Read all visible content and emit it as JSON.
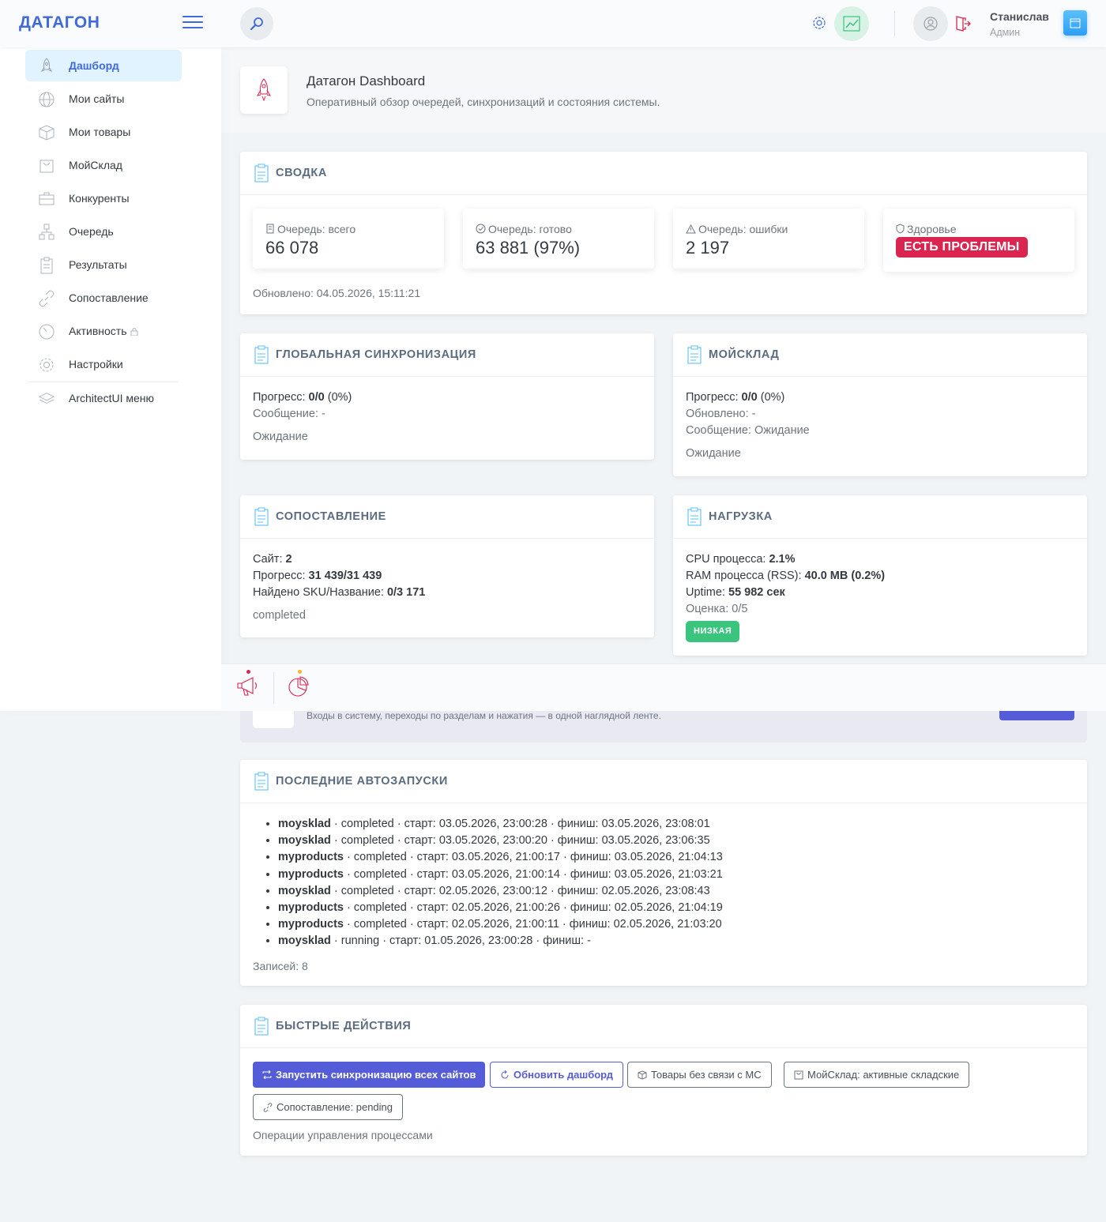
{
  "header": {
    "logo": "ДАТАГОН",
    "user_name": "Станислав",
    "user_role": "Админ"
  },
  "sidebar": {
    "items": [
      {
        "label": "Дашборд",
        "icon": "rocket-icon",
        "active": true
      },
      {
        "label": "Мои сайты",
        "icon": "globe-icon"
      },
      {
        "label": "Мои товары",
        "icon": "box-icon"
      },
      {
        "label": "МойСклад",
        "icon": "bag-icon"
      },
      {
        "label": "Конкуренты",
        "icon": "briefcase-icon"
      },
      {
        "label": "Очередь",
        "icon": "network-icon"
      },
      {
        "label": "Результаты",
        "icon": "clipboard-icon"
      },
      {
        "label": "Сопоставление",
        "icon": "link-icon"
      },
      {
        "label": "Активность",
        "icon": "timer-icon",
        "locked": true
      },
      {
        "label": "Настройки",
        "icon": "gear-icon"
      },
      {
        "label": "ArchitectUI меню",
        "icon": "layers-icon"
      }
    ]
  },
  "page": {
    "title": "Датагон Dashboard",
    "subtitle": "Оперативный обзор очередей, синхронизаций и состояния системы."
  },
  "summary": {
    "title": "СВОДКА",
    "stats": [
      {
        "label": "Очередь: всего",
        "value": "66 078",
        "icon": "doc-icon"
      },
      {
        "label": "Очередь: готово",
        "value": "63 881 (97%)",
        "icon": "check-circle-icon"
      },
      {
        "label": "Очередь: ошибки",
        "value": "2 197",
        "icon": "warning-icon"
      },
      {
        "label": "Здоровье",
        "badge": "ЕСТЬ ПРОБЛЕМЫ",
        "icon": "shield-icon"
      }
    ],
    "updated": "Обновлено: 04.05.2026, 15:11:21"
  },
  "global_sync": {
    "title": "ГЛОБАЛЬНАЯ СИНХРОНИЗАЦИЯ",
    "progress_label": "Прогресс:",
    "progress_value": "0/0",
    "progress_pct": "(0%)",
    "message": "Сообщение: -",
    "status": "Ожидание"
  },
  "moysklad": {
    "title": "МОЙСКЛАД",
    "progress_label": "Прогресс:",
    "progress_value": "0/0",
    "progress_pct": "(0%)",
    "updated": "Обновлено: -",
    "message": "Сообщение: Ожидание",
    "status": "Ожидание"
  },
  "matching": {
    "title": "СОПОСТАВЛЕНИЕ",
    "site_label": "Сайт:",
    "site_value": "2",
    "progress_label": "Прогресс:",
    "progress_value": "31 439/31 439",
    "found_label": "Найдено SKU/Название:",
    "found_value": "0/3 171",
    "status": "completed"
  },
  "load": {
    "title": "НАГРУЗКА",
    "cpu_label": "CPU процесса:",
    "cpu_value": "2.1%",
    "ram_label": "RAM процесса (RSS):",
    "ram_value": "40.0 MB (0.2%)",
    "uptime_label": "Uptime:",
    "uptime_value": "55 982 сек",
    "score": "Оценка: 0/5",
    "badge": "НИЗКАЯ"
  },
  "activity": {
    "text": "Входы в систему, переходы по разделам и нажатия — в одной наглядной ленте."
  },
  "runs": {
    "title": "ПОСЛЕДНИЕ АВТОЗАПУСКИ",
    "items": [
      {
        "name": "moysklad",
        "rest": " · completed · старт: 03.05.2026, 23:00:28 · финиш: 03.05.2026, 23:08:01"
      },
      {
        "name": "moysklad",
        "rest": " · completed · старт: 03.05.2026, 23:00:20 · финиш: 03.05.2026, 23:06:35"
      },
      {
        "name": "myproducts",
        "rest": " · completed · старт: 03.05.2026, 21:00:17 · финиш: 03.05.2026, 21:04:13"
      },
      {
        "name": "myproducts",
        "rest": " · completed · старт: 03.05.2026, 21:00:14 · финиш: 03.05.2026, 21:03:21"
      },
      {
        "name": "moysklad",
        "rest": " · completed · старт: 02.05.2026, 23:00:12 · финиш: 02.05.2026, 23:08:43"
      },
      {
        "name": "myproducts",
        "rest": " · completed · старт: 02.05.2026, 21:00:26 · финиш: 02.05.2026, 21:04:19"
      },
      {
        "name": "myproducts",
        "rest": " · completed · старт: 02.05.2026, 21:00:11 · финиш: 02.05.2026, 21:03:20"
      },
      {
        "name": "moysklad",
        "rest": " · running · старт: 01.05.2026, 23:00:28 · финиш: -"
      }
    ],
    "count": "Записей: 8"
  },
  "actions": {
    "title": "БЫСТРЫЕ ДЕЙСТВИЯ",
    "sync_all": "Запустить синхронизацию всех сайтов",
    "refresh": "Обновить дашборд",
    "unlinked": "Товары без связи с МС",
    "warehouses": "МойСклад: активные складские",
    "pending": "Сопоставление: pending",
    "footer": "Операции управления процессами"
  },
  "colors": {
    "brand": "#3f6ad8",
    "primary": "#545cd8",
    "danger": "#d92550",
    "success": "#3ac47d"
  }
}
